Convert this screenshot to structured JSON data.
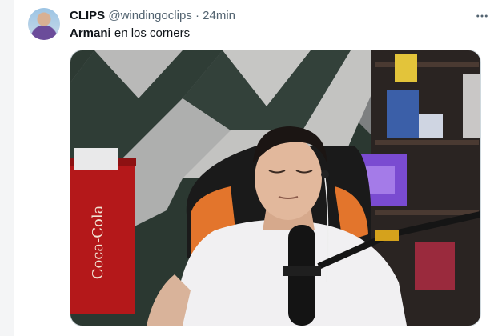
{
  "tweet": {
    "display_name": "CLIPS",
    "handle": "@windingoclips",
    "separator": "·",
    "time": "24min",
    "text_bold": "Armani",
    "text_rest": " en los corners",
    "more_icon": "more-horizontal-icon"
  },
  "media": {
    "fridge_brand": "Coca-Cola",
    "description_icon": "video-thumbnail"
  }
}
